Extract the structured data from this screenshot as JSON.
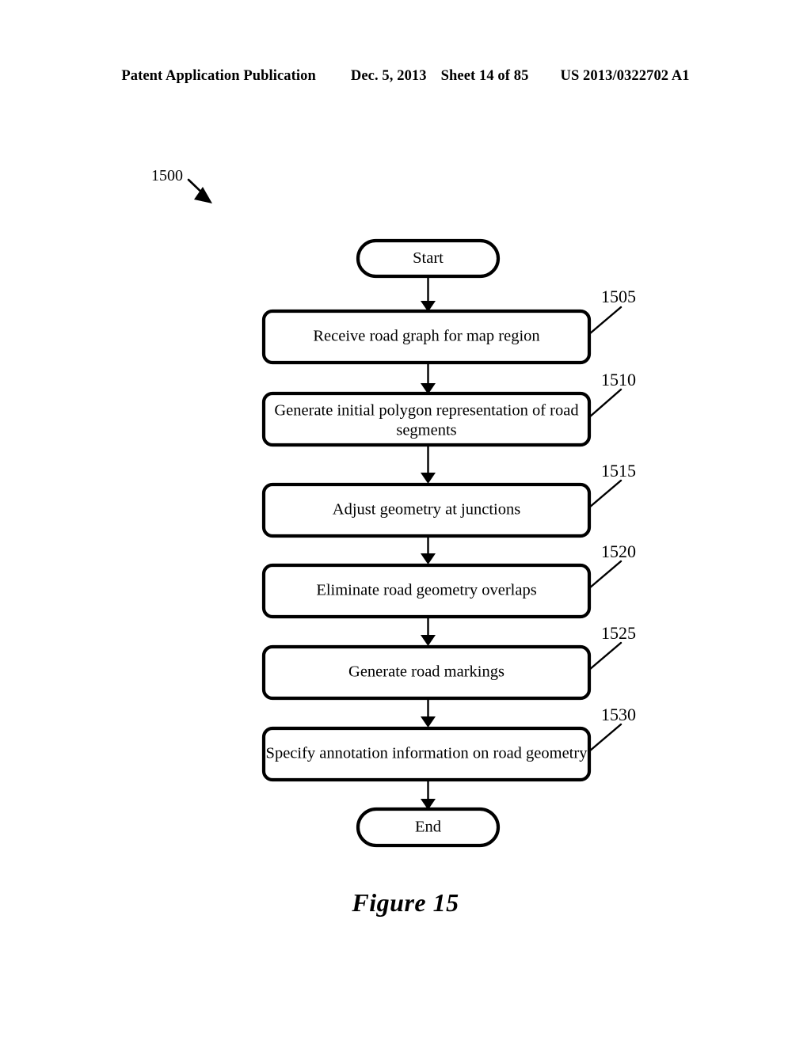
{
  "header": {
    "publication": "Patent Application Publication",
    "date": "Dec. 5, 2013",
    "sheet": "Sheet 14 of 85",
    "patent_number": "US 2013/0322702 A1"
  },
  "figure": {
    "caption": "Figure 15",
    "process_ref": "1500"
  },
  "flowchart": {
    "start_label": "Start",
    "end_label": "End",
    "steps": [
      {
        "ref": "1505",
        "lines": [
          "Receive road graph for map region"
        ]
      },
      {
        "ref": "1510",
        "lines": [
          "Generate initial polygon representation of road",
          "segments"
        ]
      },
      {
        "ref": "1515",
        "lines": [
          "Adjust geometry at junctions"
        ]
      },
      {
        "ref": "1520",
        "lines": [
          "Eliminate road geometry overlaps"
        ]
      },
      {
        "ref": "1525",
        "lines": [
          "Generate road markings"
        ]
      },
      {
        "ref": "1530",
        "lines": [
          "Specify annotation information on road geometry"
        ]
      }
    ]
  },
  "colors": {
    "ink": "#000000",
    "paper": "#ffffff"
  }
}
